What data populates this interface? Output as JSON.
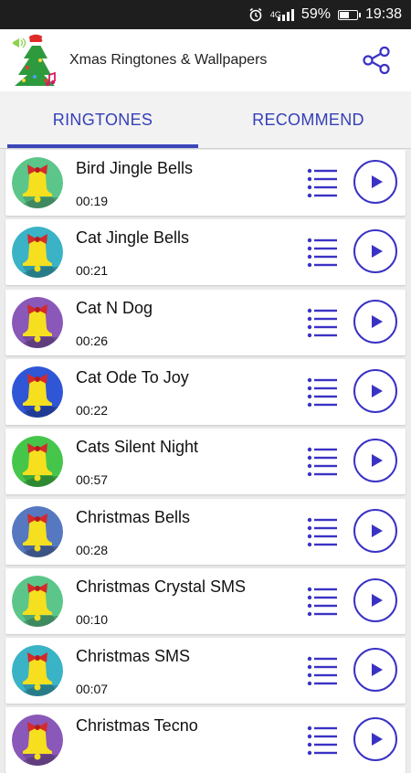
{
  "status_bar": {
    "network": "4G",
    "battery": "59%",
    "battery_level": 0.59,
    "time": "19:38",
    "icons": [
      "alarm-icon",
      "signal-icon",
      "battery-icon"
    ]
  },
  "app_bar": {
    "title": "Xmas Ringtones & Wallpapers",
    "logo": "christmas-tree-logo",
    "share_icon": "share-icon"
  },
  "tabs": [
    {
      "label": "RINGTONES",
      "active": true
    },
    {
      "label": "RECOMMEND",
      "active": false
    }
  ],
  "ringtones": [
    {
      "title": "Bird Jingle Bells",
      "duration": "00:19",
      "color": "#5cc68a"
    },
    {
      "title": "Cat Jingle Bells",
      "duration": "00:21",
      "color": "#3ab3c6"
    },
    {
      "title": "Cat N Dog",
      "duration": "00:26",
      "color": "#8a58b8"
    },
    {
      "title": "Cat Ode To Joy",
      "duration": "00:22",
      "color": "#2f56d6"
    },
    {
      "title": "Cats Silent Night",
      "duration": "00:57",
      "color": "#45c64b"
    },
    {
      "title": "Christmas Bells",
      "duration": "00:28",
      "color": "#5678c0"
    },
    {
      "title": "Christmas Crystal SMS",
      "duration": "00:10",
      "color": "#5cc68a"
    },
    {
      "title": "Christmas SMS",
      "duration": "00:07",
      "color": "#3ab3c6"
    },
    {
      "title": "Christmas Tecno",
      "duration": "",
      "color": "#8a58b8"
    }
  ],
  "colors": {
    "accent": "#3a47b9",
    "play": "#3a32c4",
    "menu": "#3a32c4",
    "bell": "#f5df1f",
    "bow": "#d42a2a"
  }
}
